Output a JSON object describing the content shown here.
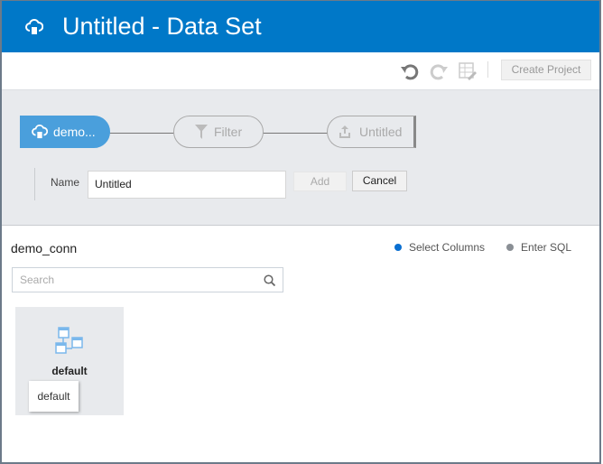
{
  "header": {
    "title": "Untitled - Data Set",
    "icon": "cloud-database-icon"
  },
  "toolbar": {
    "create_project": "Create Project"
  },
  "flow": {
    "nodes": [
      {
        "label": "demo...",
        "icon": "cloud-database-icon"
      },
      {
        "label": "Filter",
        "icon": "filter-icon"
      },
      {
        "label": "Untitled",
        "icon": "upload-icon"
      }
    ]
  },
  "form": {
    "name_label": "Name",
    "name_value": "Untitled",
    "add": "Add",
    "cancel": "Cancel"
  },
  "content": {
    "connection": "demo_conn",
    "options": [
      {
        "label": "Select Columns",
        "selected": true
      },
      {
        "label": "Enter SQL",
        "selected": false
      }
    ],
    "search_placeholder": "Search",
    "schema": {
      "name": "default",
      "tooltip": "default"
    }
  },
  "colors": {
    "brand": "#0078c8",
    "active_node": "#4a9fdc"
  }
}
